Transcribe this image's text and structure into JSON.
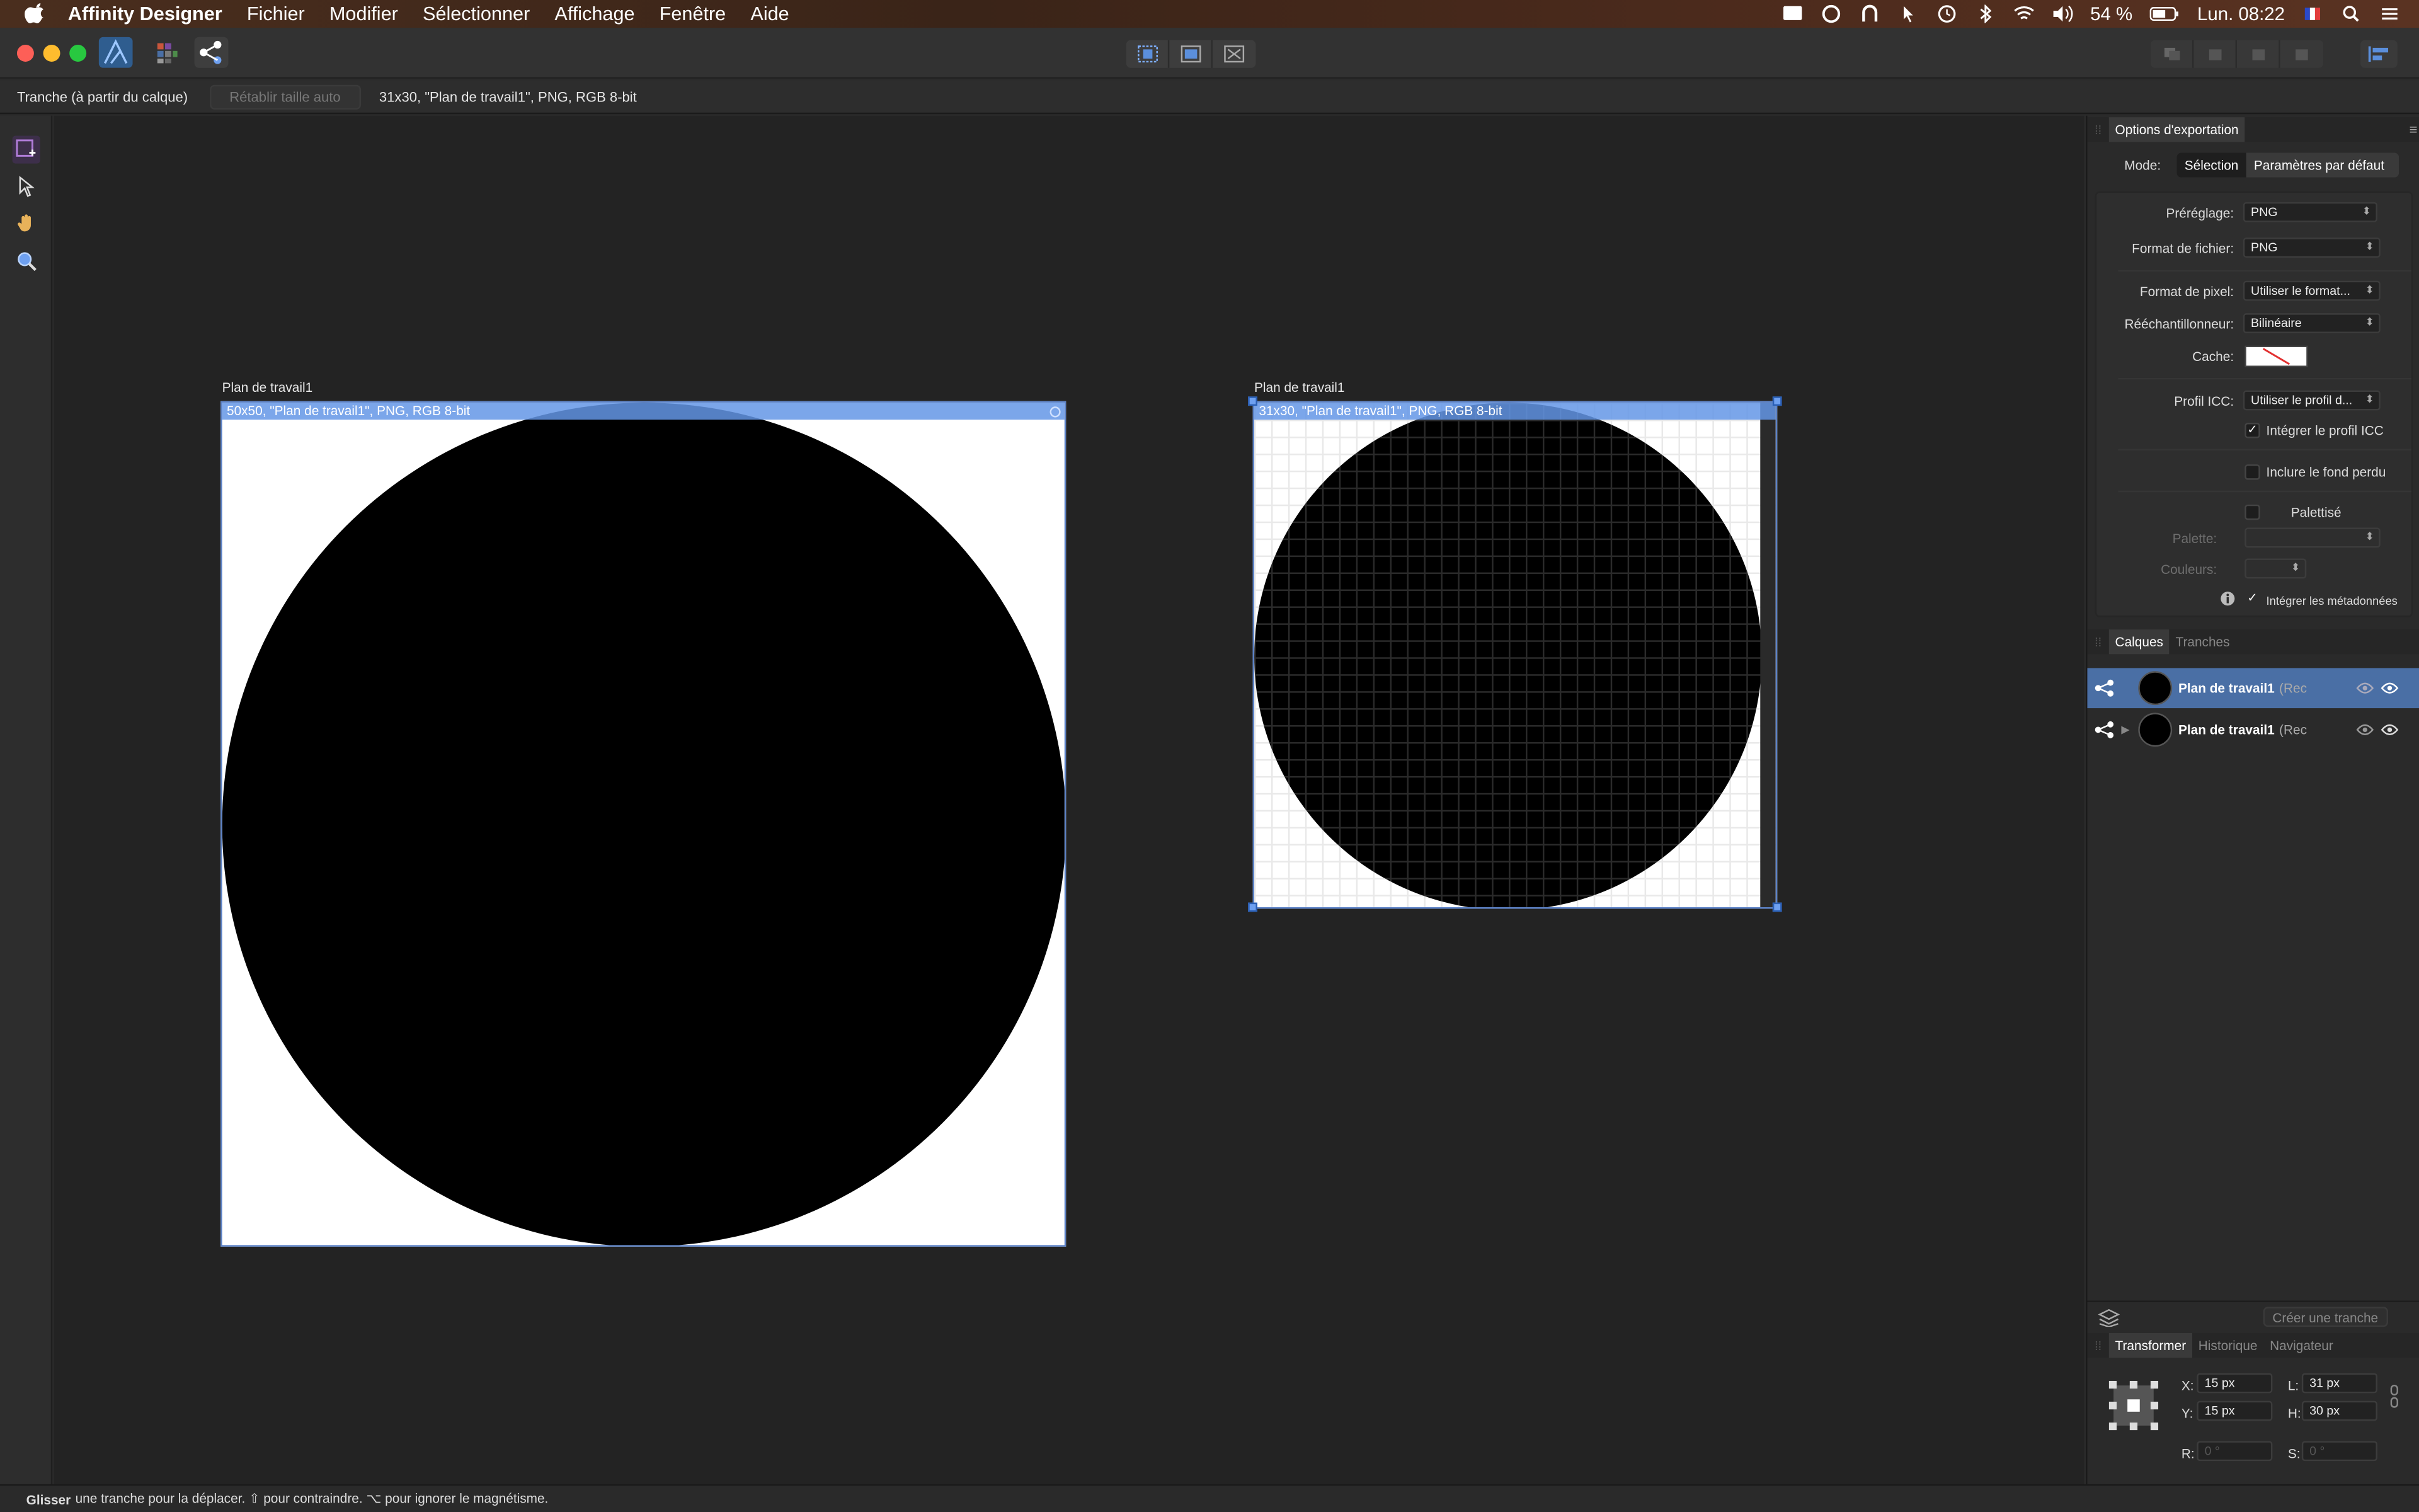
{
  "menubar": {
    "app": "Affinity Designer",
    "items": [
      "Fichier",
      "Modifier",
      "Sélectionner",
      "Affichage",
      "Fenêtre",
      "Aide"
    ],
    "battery": "54 %",
    "clock": "Lun. 08:22"
  },
  "context": {
    "tool_label": "Tranche (à partir du calque)",
    "auto_size_button": "Rétablir taille auto",
    "slice_info": "31x30, \"Plan de travail1\", PNG, RGB 8-bit"
  },
  "canvas": {
    "artboard1": {
      "label": "Plan de travail1",
      "slice": "50x50, \"Plan de travail1\", PNG, RGB 8-bit"
    },
    "artboard2": {
      "label": "Plan de travail1",
      "slice": "31x30, \"Plan de travail1\", PNG, RGB 8-bit"
    }
  },
  "export": {
    "tab": "Options d'exportation",
    "mode_label": "Mode:",
    "mode_selection": "Sélection",
    "mode_defaults": "Paramètres par défaut",
    "preset_label": "Préréglage:",
    "preset_value": "PNG",
    "format_label": "Format de fichier:",
    "format_value": "PNG",
    "pixel_label": "Format de pixel:",
    "pixel_value": "Utiliser le format...",
    "resampler_label": "Rééchantillonneur:",
    "resampler_value": "Bilinéaire",
    "matte_label": "Cache:",
    "icc_label": "Profil ICC:",
    "icc_value": "Utiliser le profil d...",
    "embed_icc": "Intégrer le profil ICC",
    "bleed": "Inclure le fond perdu",
    "palettised": "Palettisé",
    "palette_label": "Palette:",
    "colors_label": "Couleurs:",
    "metadata": "Intégrer les métadonnées"
  },
  "layers": {
    "tab_layers": "Calques",
    "tab_slices": "Tranches",
    "rows": [
      {
        "name": "Plan de travail1",
        "type": "(Rec"
      },
      {
        "name": "Plan de travail1",
        "type": "(Rec"
      }
    ],
    "create_slice": "Créer une tranche"
  },
  "transform": {
    "tab_transform": "Transformer",
    "tab_history": "Historique",
    "tab_navigator": "Navigateur",
    "x_label": "X:",
    "x_value": "15 px",
    "y_label": "Y:",
    "y_value": "15 px",
    "w_label": "L:",
    "w_value": "31 px",
    "h_label": "H:",
    "h_value": "30 px",
    "r_label": "R:",
    "r_value": "0 °",
    "s_label": "S:",
    "s_value": "0 °"
  },
  "status": {
    "bold": "Glisser",
    "text": "une tranche pour la déplacer. ⇧ pour contraindre. ⌥ pour ignorer le magnétisme."
  },
  "colors": {
    "accent": "#6ea0f0",
    "selection_row": "#4a6fa5"
  }
}
